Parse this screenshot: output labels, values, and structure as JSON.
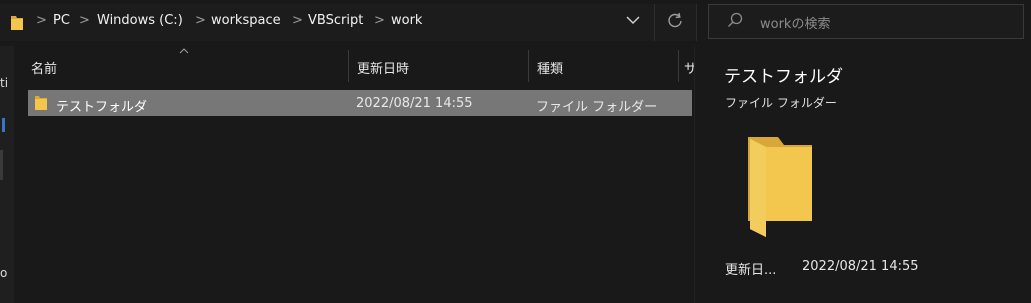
{
  "address": {
    "crumbs": [
      "PC",
      "Windows (C:)",
      "workspace",
      "VBScript",
      "work"
    ],
    "separator": ">"
  },
  "search": {
    "placeholder": "workの検索"
  },
  "columns": {
    "name": "名前",
    "modified": "更新日時",
    "type": "種類",
    "size_partial": "サ"
  },
  "files": [
    {
      "name": "テストフォルダ",
      "modified": "2022/08/21 14:55",
      "type": "ファイル フォルダー",
      "selected": true
    }
  ],
  "details": {
    "title": "テストフォルダ",
    "subtitle": "ファイル フォルダー",
    "prop_label": "更新日...",
    "prop_value": "2022/08/21 14:55"
  },
  "nav_partial": {
    "a": "ti",
    "b": "o"
  },
  "colors": {
    "folder": "#f3c74d",
    "selection": "#777777"
  },
  "icons": {
    "folder": "folder-icon",
    "down": "chevron-down-icon",
    "refresh": "refresh-icon",
    "search": "search-icon"
  }
}
